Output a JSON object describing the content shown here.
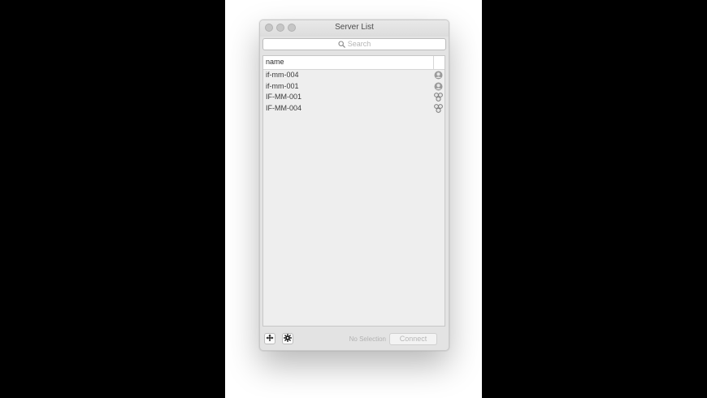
{
  "window": {
    "title": "Server List"
  },
  "search": {
    "placeholder": "Search"
  },
  "list": {
    "column_header": "name",
    "rows": [
      {
        "name": "if-mm-004",
        "icon": "single-user-icon"
      },
      {
        "name": "if-mm-001",
        "icon": "single-user-icon"
      },
      {
        "name": "IF-MM-001",
        "icon": "user-group-icon"
      },
      {
        "name": "IF-MM-004",
        "icon": "user-group-icon"
      }
    ]
  },
  "footer": {
    "add_icon": "add-server-icon",
    "settings_icon": "gear-icon",
    "status": "No Selection",
    "connect_label": "Connect"
  },
  "colors": {
    "background": "#000000",
    "window_bg": "#e3e3e3",
    "list_bg": "#eeeeee",
    "disabled_text": "#b7b7b7"
  }
}
